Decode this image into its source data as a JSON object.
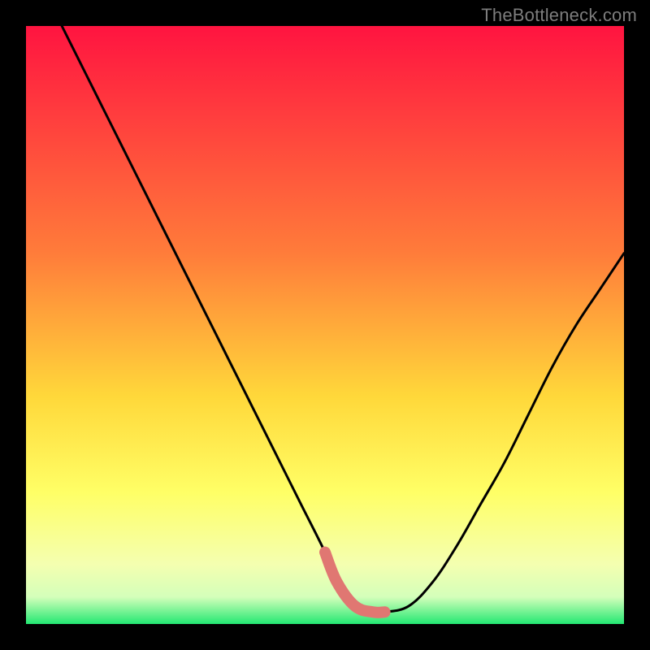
{
  "watermark": {
    "text": "TheBottleneck.com"
  },
  "colors": {
    "frame": "#000000",
    "curve": "#000000",
    "highlight": "#e07772",
    "gradient_top": "#ff1440",
    "gradient_mid1": "#ff7c3a",
    "gradient_mid2": "#ffd83a",
    "gradient_mid3": "#ffff66",
    "gradient_mid4": "#f4ffb0",
    "gradient_band": "#d4ffba",
    "gradient_bottom": "#23e872"
  },
  "chart_data": {
    "type": "line",
    "title": "",
    "xlabel": "",
    "ylabel": "",
    "xlim": [
      0,
      100
    ],
    "ylim": [
      0,
      100
    ],
    "series": [
      {
        "name": "bottleneck-curve",
        "x": [
          6,
          10,
          14,
          18,
          22,
          26,
          30,
          34,
          38,
          42,
          46,
          50,
          52,
          55,
          58,
          60,
          64,
          68,
          72,
          76,
          80,
          84,
          88,
          92,
          96,
          100
        ],
        "values": [
          100,
          92,
          84,
          76,
          68,
          60,
          52,
          44,
          36,
          28,
          20,
          12,
          7,
          3,
          2,
          2,
          3,
          7,
          13,
          20,
          27,
          35,
          43,
          50,
          56,
          62
        ]
      }
    ],
    "highlight_range_x": [
      50,
      60
    ],
    "annotations": []
  }
}
